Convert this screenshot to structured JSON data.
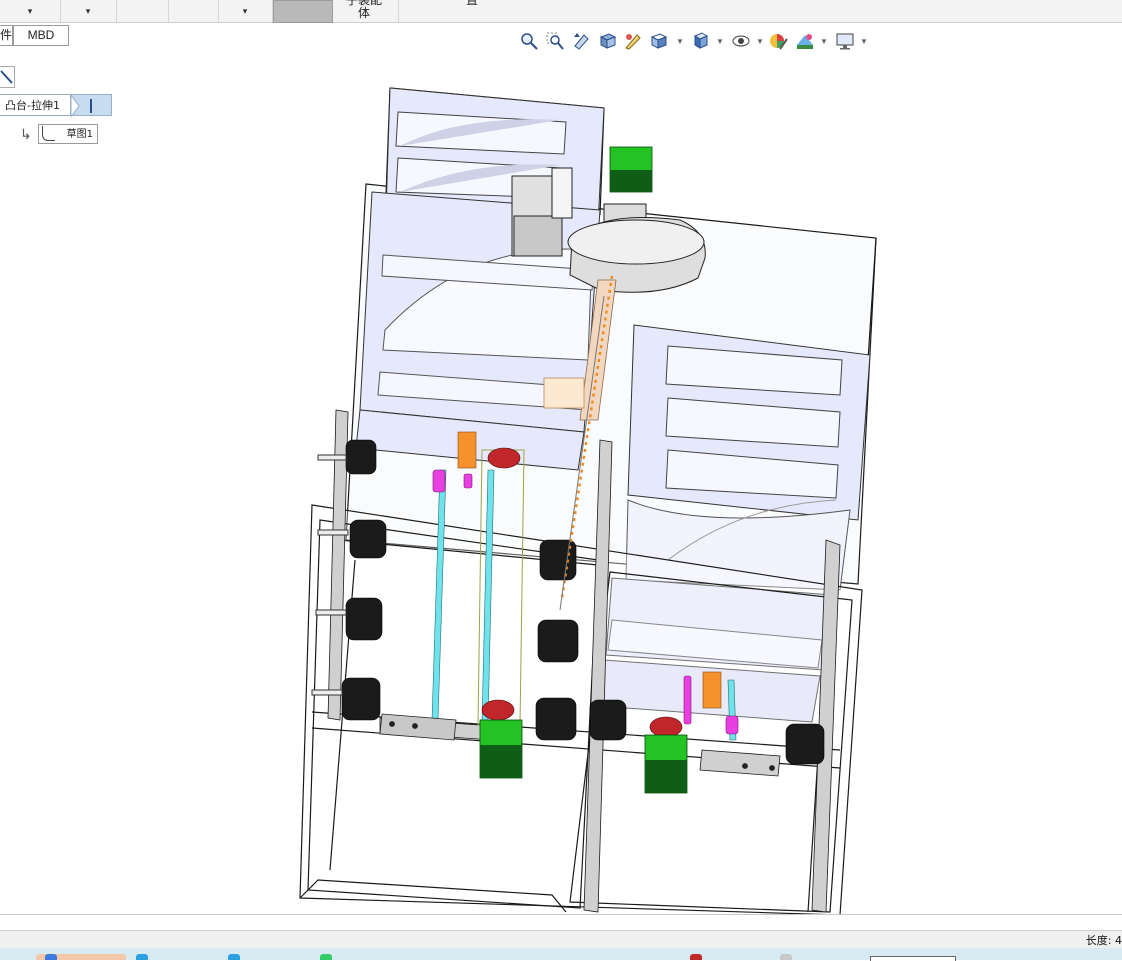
{
  "ribbon": {
    "cells": [
      "▾",
      "▾",
      "▾"
    ],
    "active_tool": "",
    "tool_instant_label": "子装配\n体",
    "tool_settings_label": "置"
  },
  "tabs": {
    "left_partial": "件",
    "mbd": "MBD"
  },
  "heads_up_toolbar": {
    "icons": [
      "zoom-to-fit-icon",
      "zoom-area-icon",
      "previous-view-icon",
      "section-view-icon",
      "dynamic-annotation-icon",
      "view-orientation-icon",
      "display-style-icon",
      "hide-show-items-icon",
      "edit-appearance-icon",
      "apply-scene-icon",
      "view-settings-icon"
    ]
  },
  "feature_tree": {
    "feature_label": "凸台-拉伸1",
    "sketch_label": "草图1"
  },
  "status": {
    "length_label": "长度: 4"
  },
  "colors": {
    "frame_edge": "#1a1a1a",
    "panel_lavender": "#e6e8fb",
    "motor_green": "#22c323",
    "wheel_black": "#1b1b1b",
    "shaft_cyan": "#6fe3ec",
    "part_magenta": "#e93ee0",
    "part_orange": "#f5922b",
    "part_red": "#c0262a",
    "guide_orange_dotted": "#f08a1c",
    "feature_highlight": "#c7dcf0",
    "taskbar_bg": "#d8eaf2"
  }
}
